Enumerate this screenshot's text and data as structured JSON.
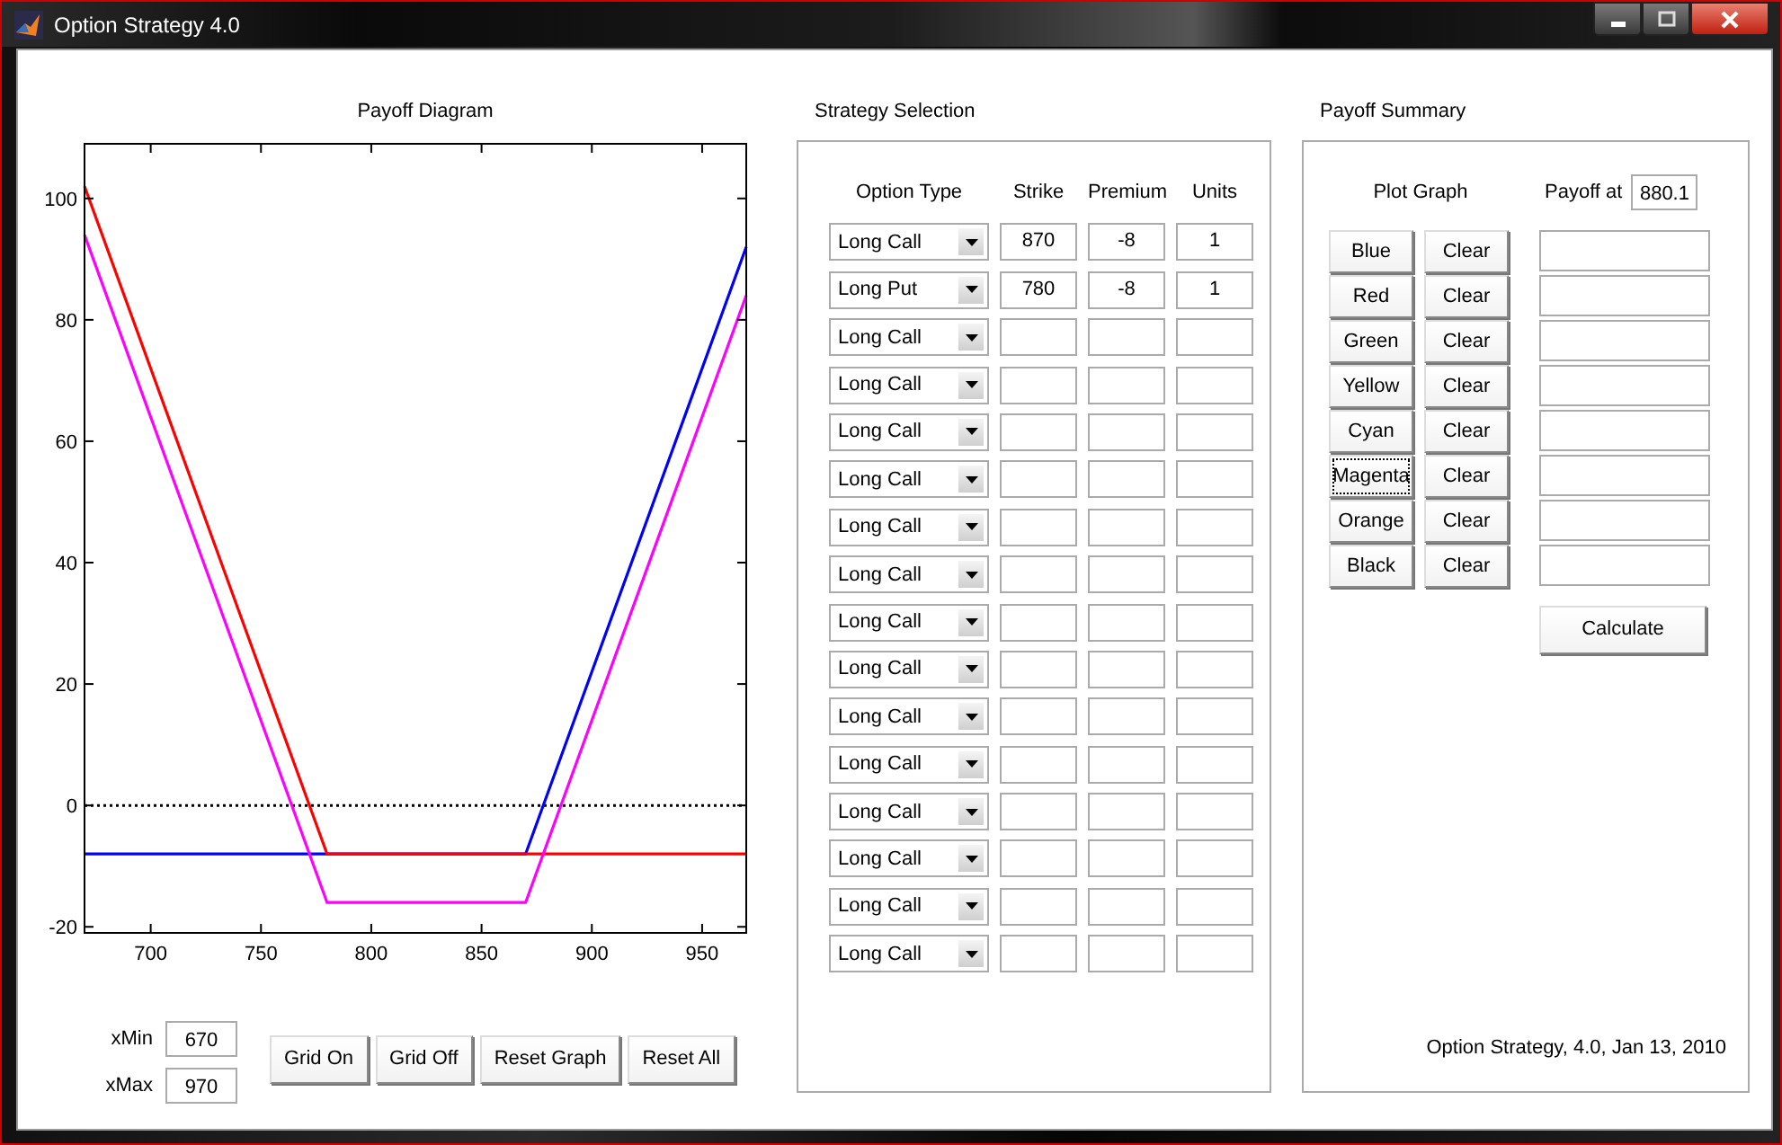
{
  "window": {
    "title": "Option Strategy 4.0"
  },
  "payoff_diagram": {
    "title": "Payoff Diagram",
    "chart_data": {
      "type": "line",
      "x": [
        670,
        780,
        870,
        970
      ],
      "series": [
        {
          "color": "#0000ff",
          "values": [
            -8,
            -8,
            -8,
            92
          ]
        },
        {
          "color": "#ff0000",
          "values": [
            102,
            -8,
            -8,
            -8
          ]
        },
        {
          "color": "#ff00ff",
          "values": [
            94,
            -16,
            -16,
            84
          ]
        }
      ],
      "xlim": [
        670,
        970
      ],
      "ylim": [
        -21,
        109
      ],
      "xticks": [
        700,
        750,
        800,
        850,
        900,
        950
      ],
      "yticks": [
        -20,
        0,
        20,
        40,
        60,
        80,
        100
      ],
      "ref_lines": [
        {
          "axis": "y",
          "value": 0
        }
      ]
    },
    "x_min": {
      "label": "xMin",
      "value": "670"
    },
    "x_max": {
      "label": "xMax",
      "value": "970"
    },
    "buttons": [
      "Grid On",
      "Grid Off",
      "Reset Graph",
      "Reset All"
    ]
  },
  "strategy_selection": {
    "title": "Strategy Selection",
    "columns": [
      "Option Type",
      "Strike",
      "Premium",
      "Units"
    ],
    "rows": [
      {
        "option_type": "Long Call",
        "strike": "870",
        "premium": "-8",
        "units": "1"
      },
      {
        "option_type": "Long Put",
        "strike": "780",
        "premium": "-8",
        "units": "1"
      },
      {
        "option_type": "Long Call"
      },
      {
        "option_type": "Long Call"
      },
      {
        "option_type": "Long Call"
      },
      {
        "option_type": "Long Call"
      },
      {
        "option_type": "Long Call"
      },
      {
        "option_type": "Long Call"
      },
      {
        "option_type": "Long Call"
      },
      {
        "option_type": "Long Call"
      },
      {
        "option_type": "Long Call"
      },
      {
        "option_type": "Long Call"
      },
      {
        "option_type": "Long Call"
      },
      {
        "option_type": "Long Call"
      },
      {
        "option_type": "Long Call"
      },
      {
        "option_type": "Long Call"
      }
    ]
  },
  "payoff_summary": {
    "title": "Payoff Summary",
    "plot_graph_label": "Plot Graph",
    "payoff_at": {
      "label": "Payoff at",
      "value": "880.1"
    },
    "rows": [
      {
        "plot": "Blue",
        "focused": false,
        "clear": "Clear"
      },
      {
        "plot": "Red",
        "focused": false,
        "clear": "Clear"
      },
      {
        "plot": "Green",
        "focused": false,
        "clear": "Clear"
      },
      {
        "plot": "Yellow",
        "focused": false,
        "clear": "Clear"
      },
      {
        "plot": "Cyan",
        "focused": false,
        "clear": "Clear"
      },
      {
        "plot": "Magenta",
        "focused": true,
        "clear": "Clear"
      },
      {
        "plot": "Orange",
        "focused": false,
        "clear": "Clear"
      },
      {
        "plot": "Black",
        "focused": false,
        "clear": "Clear"
      }
    ],
    "calculate": "Calculate",
    "footer": "Option Strategy, 4.0, Jan 13, 2010"
  }
}
